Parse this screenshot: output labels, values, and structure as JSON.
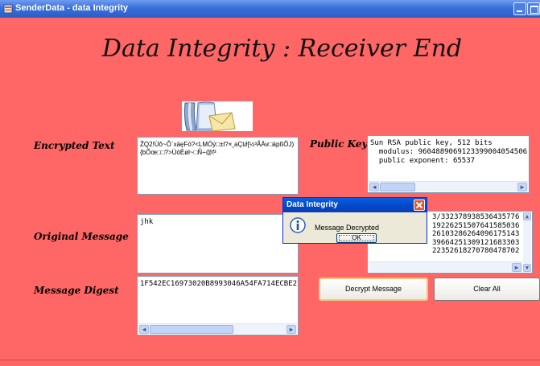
{
  "window": {
    "title": "SenderData - data Integrity"
  },
  "heading": "Data Integrity : Receiver End",
  "labels": {
    "encrypted_text": "Encrypted Text",
    "public_key": "Public Key",
    "original_message": "Original Message",
    "message_digest": "Message Digest"
  },
  "fields": {
    "encrypted_text": "ŽQ2!Ùõ~Ô`xāȩFó?<LMÓý□±l?×¸aÇt∂[½³ÃÄv□äpßÔJ)\n{bÕœ□□?>ÙòÈøl~□Ñ÷@f³",
    "public_key": "Sun RSA public key, 512 bits\n  modulus: 9604889069123399004054506\n  public exponent: 65537",
    "public_key_back": "3/332378938536435776\n19226251507641585036\n26103286264096175143\n39664251309121683303\n22352618270780478702",
    "original_message": "jhk",
    "message_digest": "1F542EC16973020B8993046A54FA714ECBE27"
  },
  "buttons": {
    "decrypt": "Decrypt Message",
    "clear": "Clear All"
  },
  "dialog": {
    "title": "Data Integrity",
    "message": "Message Decrypted",
    "ok": "OK"
  },
  "colors": {
    "background": "#ff6666",
    "titlebar": "#3a6fd8",
    "dialog_title": "#0246c6"
  }
}
